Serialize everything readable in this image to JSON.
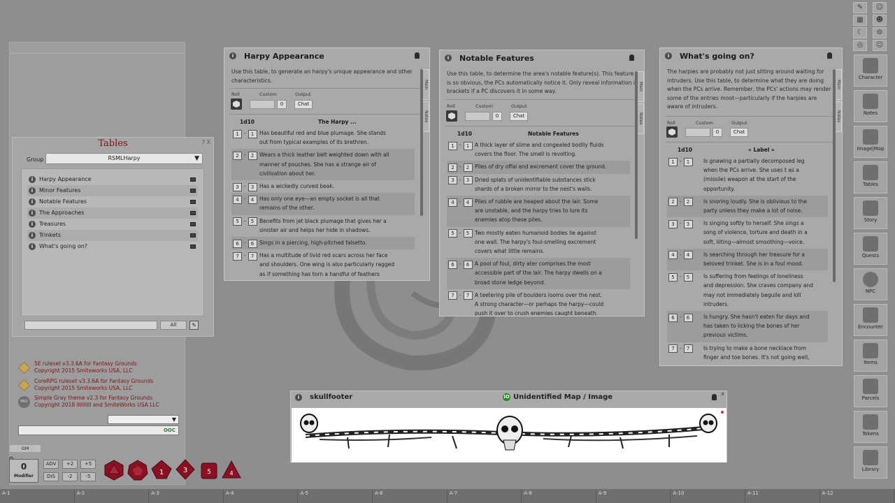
{
  "tables_window": {
    "title": "Tables",
    "controls": "? X",
    "group_label": "Group",
    "group_value": "RSMLHarpy",
    "items": [
      {
        "label": "Harpy Appearance"
      },
      {
        "label": "Minor Features"
      },
      {
        "label": "Notable Features"
      },
      {
        "label": "The Approaches"
      },
      {
        "label": "Treasures"
      },
      {
        "label": "Trinkets"
      },
      {
        "label": "What's going on?"
      }
    ],
    "filter_all": "All"
  },
  "harpy_appearance": {
    "title": "Harpy Appearance",
    "desc_lines": [
      "Use this table, to generate an harpy's unique appearance and other",
      "characteristics."
    ],
    "roll_label": "Roll",
    "custom_label": "Custom",
    "output_label": "Output",
    "custom_value": "0",
    "chat_label": "Chat",
    "dice_col": "1d10",
    "result_col": "The Harpy ...",
    "tabs": [
      "Main",
      "Notes"
    ],
    "rows": [
      {
        "from": "1",
        "to": "1",
        "lines": [
          "Has beautiful red and blue plumage. She stands",
          "out from typical examples of its brethren."
        ]
      },
      {
        "from": "2",
        "to": "2",
        "lines": [
          "Wears a thick leather belt weighted down with all",
          "manner of pouches. She has a strange air of",
          "civilisation about her."
        ]
      },
      {
        "from": "3",
        "to": "3",
        "lines": [
          "Has a wickedly curved beak."
        ]
      },
      {
        "from": "4",
        "to": "4",
        "lines": [
          "Has only one eye—an empty socket is all that",
          "remains of the other."
        ]
      },
      {
        "from": "5",
        "to": "5",
        "lines": [
          "Benefits from jet black plumage that gives her a",
          "sinister air and helps her hide in shadows."
        ]
      },
      {
        "from": "6",
        "to": "6",
        "lines": [
          "Sings in a piercing, high-pitched falsetto."
        ]
      },
      {
        "from": "7",
        "to": "7",
        "lines": [
          "Has a multitude of livid red scars across her face",
          "and shoulders. One wing is also particularly ragged",
          "as if something has torn a handful of feathers"
        ]
      }
    ]
  },
  "notable_features": {
    "title": "Notable Features",
    "desc_lines": [
      "Use this table, to determine the area's notable feature(s). This feature",
      "is so obvious, the PCs automatically notice it. Only reveal information in",
      "brackets if a PC discovers it in some way."
    ],
    "roll_label": "Roll",
    "custom_label": "Custom",
    "output_label": "Output",
    "custom_value": "0",
    "chat_label": "Chat",
    "dice_col": "1d10",
    "result_col": "Notable Features",
    "tabs": [
      "Main",
      "Notes"
    ],
    "rows": [
      {
        "from": "1",
        "to": "1",
        "lines": [
          "A thick layer of slime and congealed bodily fluids",
          "covers the floor. The smell is revolting."
        ]
      },
      {
        "from": "2",
        "to": "2",
        "lines": [
          "Piles of dry offal and excrement cover the ground."
        ]
      },
      {
        "from": "3",
        "to": "3",
        "lines": [
          "Dried splats of unidentifiable substances stick",
          "shards of a broken mirror to the nest's walls."
        ]
      },
      {
        "from": "4",
        "to": "4",
        "lines": [
          "Piles of rubble are heaped about the lair. Some",
          "are unstable, and the harpy tries to lure its",
          "enemies atop these piles."
        ]
      },
      {
        "from": "5",
        "to": "5",
        "lines": [
          "Two mostly eaten humanoid bodies lie against",
          "one wall. The harpy's foul-smelling excrement",
          "covers what little remains."
        ]
      },
      {
        "from": "6",
        "to": "6",
        "lines": [
          "A pool of foul, dirty ater comprises the most",
          "accessible part of the lair. The harpy dwells on a",
          "broad stone ledge beyond."
        ]
      },
      {
        "from": "7",
        "to": "7",
        "lines": [
          "A teetering pile of boulders looms over the nest.",
          "A strong character—or perhaps the harpy—could",
          "push it over to crush enemies caught beneath."
        ]
      }
    ]
  },
  "whats_going_on": {
    "title": "What's going on?",
    "desc_lines": [
      "The harpies are probably not just sitting around waiting for",
      "intruders. Use this table, to determine what they are doing",
      "when the PCs arrive. Remember, the PCs' actions may render",
      "some of the entries moot—particularly if the harpies are",
      "aware of intruders."
    ],
    "roll_label": "Roll",
    "custom_label": "Custom",
    "output_label": "Output",
    "custom_value": "0",
    "chat_label": "Chat",
    "dice_col": "1d10",
    "result_col": "« Label »",
    "tabs": [
      "Main",
      "Notes"
    ],
    "rows": [
      {
        "from": "1",
        "to": "1",
        "lines": [
          "Is gnawing a partially decomposed leg",
          "when the PCs arrive. She uses t as a",
          "(missile) weapon at the start of the",
          "opportunity."
        ]
      },
      {
        "from": "2",
        "to": "2",
        "lines": [
          "Is snoring loudly. She is oblivious to the",
          "party unless they make a lot of noise."
        ]
      },
      {
        "from": "3",
        "to": "3",
        "lines": [
          "Is singing softly to herself. She sings a",
          "song of violence, torture and death in a",
          "soft, lilting—almost smoothing—voice."
        ]
      },
      {
        "from": "4",
        "to": "4",
        "lines": [
          "Is searching through her treasure for a",
          "beloved trinket. She is in a foul mood."
        ]
      },
      {
        "from": "5",
        "to": "5",
        "lines": [
          "Is suffering from feelings of loneliness",
          "and depression. She craves company and",
          "may not immediately beguile and kill",
          "intruders."
        ]
      },
      {
        "from": "6",
        "to": "6",
        "lines": [
          "Is hungry. She hasn't eaten for days and",
          "has taken to licking the bones of her",
          "previous victims."
        ]
      },
      {
        "from": "7",
        "to": "7",
        "lines": [
          "Is trying to make a bone necklace from",
          "finger and toe bones. It's not going well,"
        ]
      }
    ]
  },
  "map_window": {
    "left_title": "skullfooter",
    "id_badge": "ID",
    "center_title": "Unidentified Map / Image",
    "close": "x"
  },
  "chat": {
    "rulesets": [
      {
        "line1": "5E ruleset v3.3.6A for Fantasy Grounds",
        "line2": "Copyright 2015 Smiteworks USA, LLC"
      },
      {
        "line1": "CoreRPG ruleset v3.3.6A for Fantasy Grounds",
        "line2": "Copyright 2015 Smiteworks USA, LLC"
      },
      {
        "line1": "Simple Gray theme v2.3 for Fantasy Grounds",
        "line2": "Copyright 2018 llllllllll and SmiteWorks USA LLC"
      }
    ],
    "pro_badge": "PRO",
    "ooc_label": "OOC",
    "gm_tag": "GM"
  },
  "dice_tray": {
    "modifier_value": "0",
    "modifier_label": "Modifier",
    "buttons": [
      "ADV",
      "+2",
      "+5",
      "DIS",
      "-2",
      "-5"
    ],
    "dice": [
      "d20",
      "d12",
      "d10",
      "d8",
      "d6",
      "d4"
    ],
    "dice_color": "#8a1022"
  },
  "sidebar": {
    "buttons": [
      "Character",
      "Notes",
      "Image|Map",
      "Tables",
      "Story",
      "Quests",
      "NPC",
      "Encounter",
      "Items",
      "Parcels",
      "Tokens",
      "Library"
    ],
    "top_icons": [
      "pencil-icon",
      "people-icon",
      "calendar-icon",
      "group-icon",
      "moon-icon",
      "gear-icon",
      "target-icon",
      "user-outline-icon"
    ]
  },
  "hotbar": {
    "keys": [
      "A-1",
      "A-2",
      "A-3",
      "A-4",
      "A-5",
      "A-6",
      "A-7",
      "A-8",
      "A-9",
      "A-10",
      "A-11",
      "A-12"
    ]
  },
  "colors": {
    "background": "#8e8e8e",
    "tables_title": "#7a1010",
    "ruleset_text": "#7a1616",
    "id_badge": "#1e8a1e"
  }
}
